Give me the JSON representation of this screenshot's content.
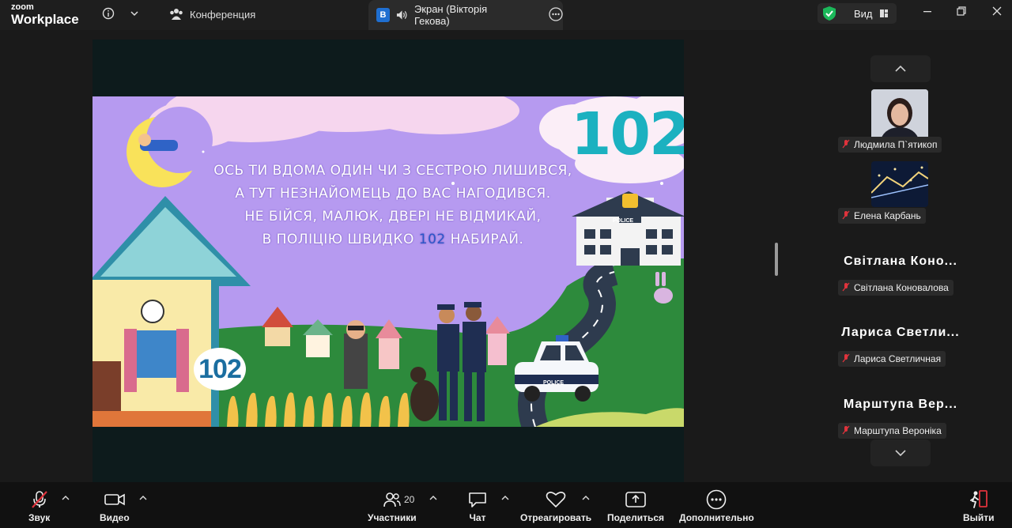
{
  "app": {
    "brand_top": "zoom",
    "brand_bottom": "Workplace"
  },
  "topbar": {
    "info_icon": "info-icon",
    "conference_label": "Конференция",
    "screen_badge": "В",
    "screen_label": "Экран (Вікторія Гекова)",
    "view_label": "Вид"
  },
  "slide": {
    "poem_lines": [
      "ОСЬ ТИ ВДОМА ОДИН ЧИ З СЕСТРОЮ ЛИШИВСЯ,",
      "А ТУТ НЕЗНАЙОМЕЦЬ ДО ВАС НАГОДИВСЯ.",
      "НЕ БІЙСЯ, МАЛЮК, ДВЕРІ НЕ ВІДМИКАЙ,"
    ],
    "poem_last_before": "В ПОЛІЦІЮ ШВИДКО",
    "poem_last_highlight": "102",
    "poem_last_after": "НАБИРАЙ.",
    "big_number": "102",
    "bubble_number": "102",
    "police_sign": "POLICE",
    "car_label": "POLICE"
  },
  "gallery": {
    "participants": [
      {
        "name": "Людмила П`ятикоп",
        "has_video": true
      },
      {
        "name": "Елена Карбань",
        "has_video": true
      },
      {
        "display_name": "Світлана  Коно...",
        "name": "Світлана Коновалова",
        "has_video": false
      },
      {
        "display_name": "Лариса  Светли...",
        "name": "Лариса Светличная",
        "has_video": false
      },
      {
        "display_name": "Марштупа  Вер...",
        "name": "Марштупа Вероніка",
        "has_video": false
      }
    ]
  },
  "toolbar": {
    "audio": "Звук",
    "video": "Видео",
    "participants": "Участники",
    "participants_count": "20",
    "chat": "Чат",
    "react": "Отреагировать",
    "share": "Поделиться",
    "more": "Дополнительно",
    "leave": "Выйти"
  },
  "colors": {
    "accent_green": "#1bb85a",
    "mute_red": "#e0333c",
    "slide_bg": "#b69af0",
    "number_teal": "#1bb1c0"
  }
}
